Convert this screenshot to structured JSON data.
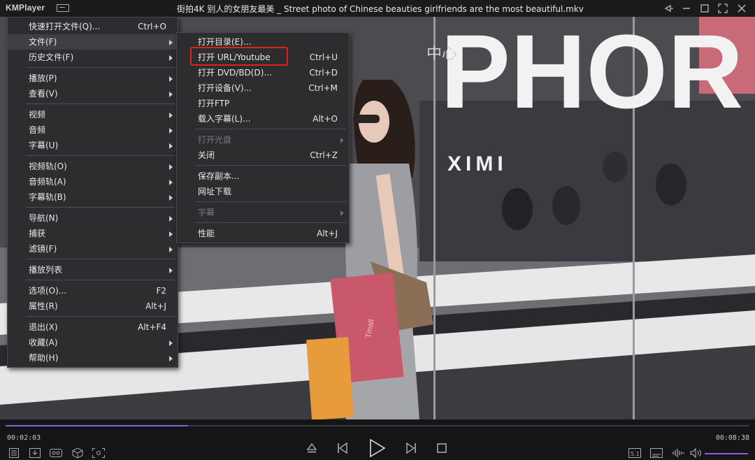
{
  "app": {
    "logo": "KMPlayer",
    "window_title": "街拍4K 别人的女朋友最美 _ Street photo of Chinese beauties girlfriends are the most beautiful.mkv"
  },
  "video": {
    "signage_text": "PHOR",
    "sub_sign_text": "XIMI",
    "chinese_sign": "中心",
    "bag_text": "Tmall"
  },
  "main_menu": {
    "items": [
      {
        "label": "快速打开文件(Q)...",
        "shortcut": "Ctrl+O"
      },
      {
        "label": "文件(F)"
      },
      {
        "label": "历史文件(F)"
      },
      {
        "label": "播放(P)"
      },
      {
        "label": "查看(V)"
      },
      {
        "label": "视频"
      },
      {
        "label": "音频"
      },
      {
        "label": "字幕(U)"
      },
      {
        "label": "视频轨(O)"
      },
      {
        "label": "音频轨(A)"
      },
      {
        "label": "字幕轨(B)"
      },
      {
        "label": "导航(N)"
      },
      {
        "label": "捕获"
      },
      {
        "label": "滤镜(F)"
      },
      {
        "label": "播放列表"
      },
      {
        "label": "选项(O)...",
        "shortcut": "F2"
      },
      {
        "label": "属性(R)",
        "shortcut": "Alt+J"
      },
      {
        "label": "退出(X)",
        "shortcut": "Alt+F4"
      },
      {
        "label": "收藏(A)"
      },
      {
        "label": "帮助(H)"
      }
    ]
  },
  "file_submenu": {
    "items": [
      {
        "label": "打开目录(E)..."
      },
      {
        "label": "打开 URL/Youtube",
        "shortcut": "Ctrl+U"
      },
      {
        "label": "打开 DVD/BD(D)...",
        "shortcut": "Ctrl+D"
      },
      {
        "label": "打开设备(V)...",
        "shortcut": "Ctrl+M"
      },
      {
        "label": "打开FTP"
      },
      {
        "label": "载入字幕(L)...",
        "shortcut": "Alt+O"
      },
      {
        "label": "打开光盘"
      },
      {
        "label": "关闭",
        "shortcut": "Ctrl+Z"
      },
      {
        "label": "保存副本..."
      },
      {
        "label": "网址下载"
      },
      {
        "label": "字幕"
      },
      {
        "label": "性能",
        "shortcut": "Alt+J"
      }
    ]
  },
  "player": {
    "elapsed": "00:02:03",
    "duration": "00:08:38",
    "progress": 0.245
  },
  "colors": {
    "accent": "#7d68d6",
    "highlight_box": "#e02020",
    "menu_bg": "#2d2d30"
  }
}
